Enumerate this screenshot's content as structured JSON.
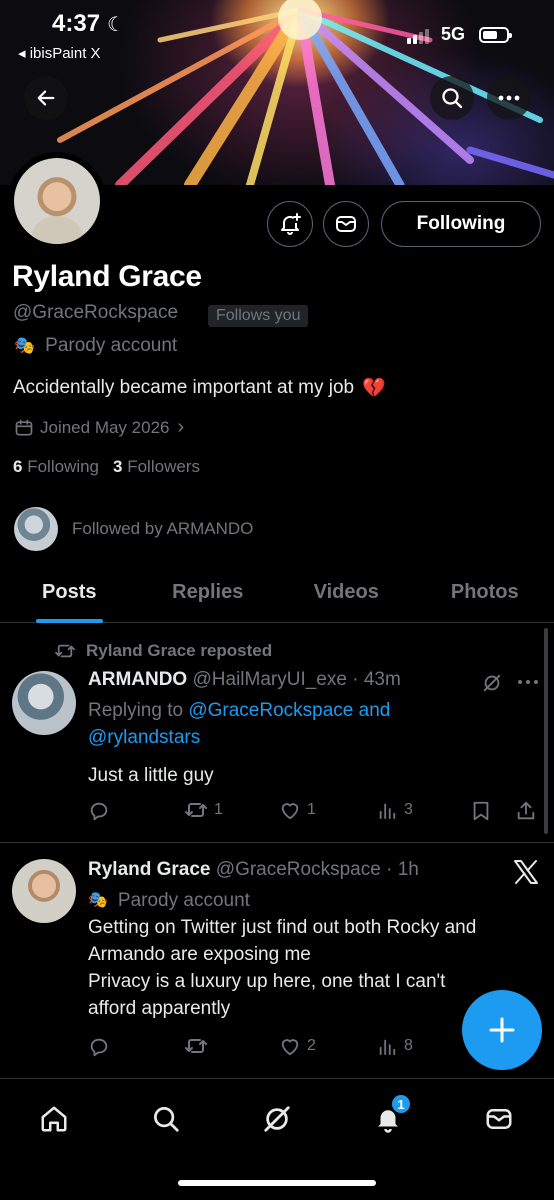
{
  "status_bar": {
    "time": "4:37",
    "back_app": "◂ ibisPaint X",
    "network": "5G"
  },
  "profile": {
    "name": "Ryland Grace",
    "handle": "@GraceRockspace",
    "follows_you": "Follows you",
    "parody_label": "Parody account",
    "bio": "Accidentally became important at my job",
    "bio_emoji": "💔",
    "joined": "Joined May 2026",
    "following_count": "6",
    "following_label": "Following",
    "followers_count": "3",
    "followers_label": "Followers",
    "followed_by": "Followed by ARMANDO"
  },
  "buttons": {
    "following": "Following"
  },
  "tabs": [
    {
      "label": "Posts"
    },
    {
      "label": "Replies"
    },
    {
      "label": "Videos"
    },
    {
      "label": "Photos"
    }
  ],
  "posts": [
    {
      "repost_label": "Ryland Grace reposted",
      "author": "ARMANDO",
      "handle": "@HailMaryUI_exe",
      "time": "· 43m",
      "replying_prefix": "Replying to ",
      "replying_to": "@GraceRockspace and",
      "replying_to_2": "@rylandstars",
      "text": "Just a little guy",
      "replies": "",
      "reposts": "1",
      "likes": "1",
      "views": "3"
    },
    {
      "author": "Ryland Grace",
      "handle": "@GraceRockspace",
      "time": "· 1h",
      "parody_label": "Parody account",
      "line1": "Getting on Twitter just find out both Rocky and",
      "line2": "Armando are exposing me",
      "line3": "Privacy is a luxury up here, one that I can't",
      "line4": "afford apparently",
      "replies": "",
      "reposts": "",
      "likes": "2",
      "views": "8"
    }
  ],
  "notifications_badge": "1",
  "colors": {
    "accent": "#1d9bf0",
    "background": "#000000",
    "secondary_text": "#71767b",
    "divider": "#2f3336"
  }
}
